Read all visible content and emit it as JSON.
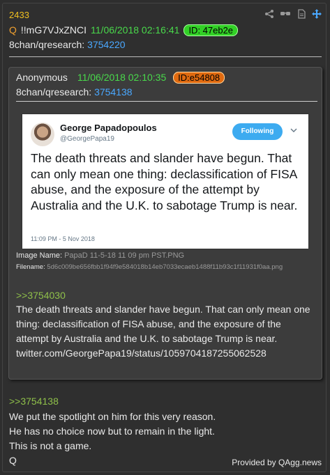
{
  "post": {
    "number": "2433",
    "q_label": "Q",
    "tripcode": "!!mG7VJxZNCI",
    "date": "11/06/2018 02:16:41",
    "id": "ID: 47eb2e",
    "board": "8chan/qresearch:",
    "board_link": "3754220"
  },
  "toolbar": {
    "icons": [
      "share-icon",
      "glasses-icon",
      "document-icon",
      "move-icon"
    ],
    "accent": "#4aa8ff"
  },
  "quoted": {
    "author": "Anonymous",
    "date": "11/06/2018 02:10:35",
    "id": "ID:e54808",
    "board": "8chan/qresearch:",
    "board_link": "3754138",
    "tweet": {
      "name": "George Papadopoulos",
      "handle": "@GeorgePapa19",
      "follow_label": "Following",
      "text": "The death threats and slander have begun. That can only mean one thing: declassification of FISA abuse, and the exposure of the attempt by Australia and the U.K. to sabotage Trump is near.",
      "time": "11:09 PM - 5 Nov 2018"
    },
    "image_name_label": "Image Name:",
    "image_name": "PapaD 11-5-18 11 09 pm PST.PNG",
    "filename_label": "Filename:",
    "filename": "5d6c009be656fbb1f94f9e584018b14eb7033ecaeb1488f11b93c1f11931f0aa.png",
    "reply_ref": ">>3754030",
    "body": [
      "The death threats and slander have begun. That can only mean one thing: declassification of FISA abuse, and the exposure of the attempt by Australia and the U.K. to sabotage Trump is near.",
      "twitter.com/GeorgePapa19/status/1059704187255062528"
    ]
  },
  "reply": {
    "ref": ">>3754138",
    "lines": [
      "We put the spotlight on him for this very reason.",
      "He has no choice now but to remain in the light.",
      "This is not a game.",
      "Q"
    ]
  },
  "credit": "Provided by QAgg.news",
  "colors": {
    "id_green": "#32d026",
    "id_orange": "#e06a10",
    "date_green": "#49d94b",
    "quote_green": "#8fc04a",
    "number_yellow": "#f0c020"
  }
}
